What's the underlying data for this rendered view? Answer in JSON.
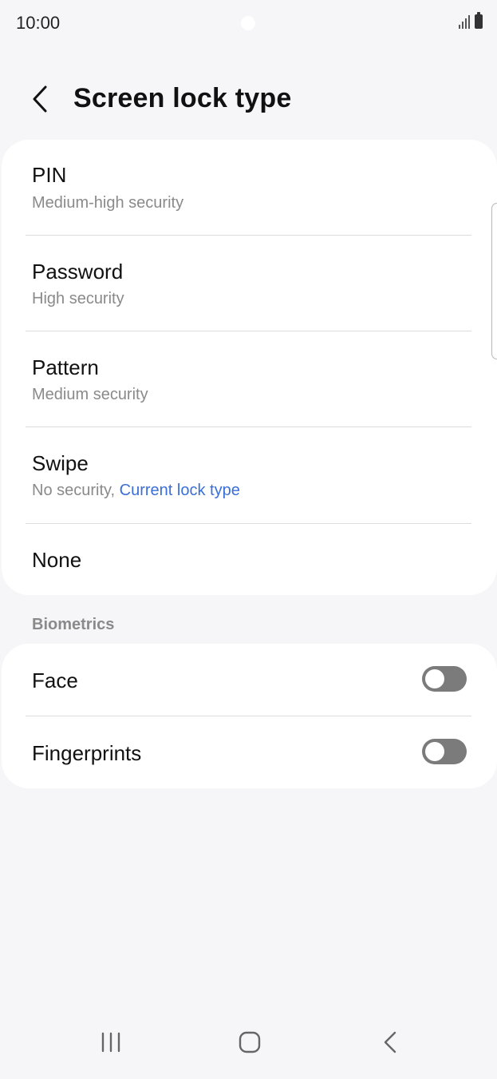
{
  "status_bar": {
    "time": "10:00",
    "icons": [
      "signal-icon",
      "battery-icon"
    ]
  },
  "header": {
    "back_icon": "chevron-left-icon",
    "title": "Screen lock type"
  },
  "lock_types": [
    {
      "title": "PIN",
      "subtitle": "Medium-high security"
    },
    {
      "title": "Password",
      "subtitle": "High security"
    },
    {
      "title": "Pattern",
      "subtitle": "Medium security"
    },
    {
      "title": "Swipe",
      "subtitle": "No security, ",
      "current_label": "Current lock type"
    },
    {
      "title": "None"
    }
  ],
  "biometrics": {
    "section_label": "Biometrics",
    "items": [
      {
        "title": "Face",
        "enabled": false
      },
      {
        "title": "Fingerprints",
        "enabled": false
      }
    ]
  },
  "colors": {
    "background": "#f6f6f8",
    "card": "#ffffff",
    "accent": "#3b6fd8",
    "toggle_off": "#7b7b7b"
  },
  "nav_bar": {
    "icons": [
      "recents-icon",
      "home-icon",
      "back-icon"
    ]
  }
}
